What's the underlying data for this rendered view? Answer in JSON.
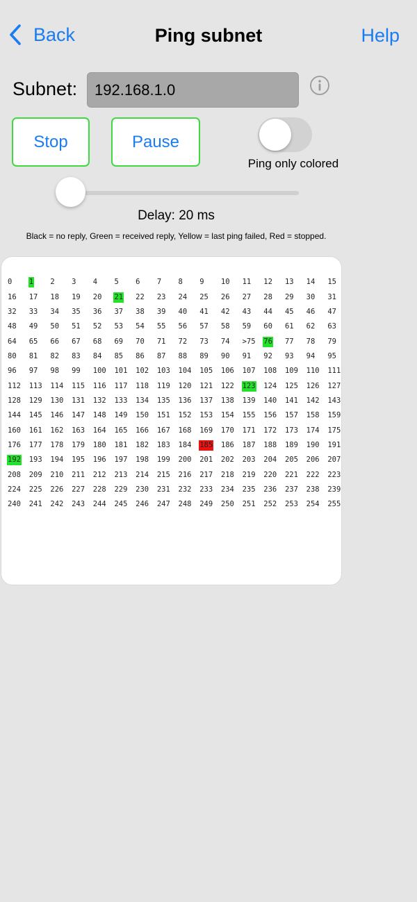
{
  "nav": {
    "back_label": "Back",
    "title": "Ping subnet",
    "help_label": "Help"
  },
  "subnet": {
    "label": "Subnet:",
    "value": "192.168.1.0",
    "info_icon": "info-icon"
  },
  "buttons": {
    "stop": "Stop",
    "pause": "Pause"
  },
  "toggle": {
    "label": "Ping only colored",
    "on": false
  },
  "slider": {
    "value_fraction": 0.06
  },
  "delay_text": "Delay: 20 ms",
  "legend": "Black = no reply, Green = received reply, Yellow = last ping failed, Red = stopped.",
  "colors": {
    "accent": "#1a7cf0",
    "green": "#22e32a",
    "red": "#ee1111",
    "button_border": "#3fd93f"
  },
  "hosts": {
    "current_label": ">75",
    "current_index": 75,
    "green": [
      1,
      21,
      76,
      123,
      192
    ],
    "red": [
      185
    ],
    "yellow": []
  }
}
